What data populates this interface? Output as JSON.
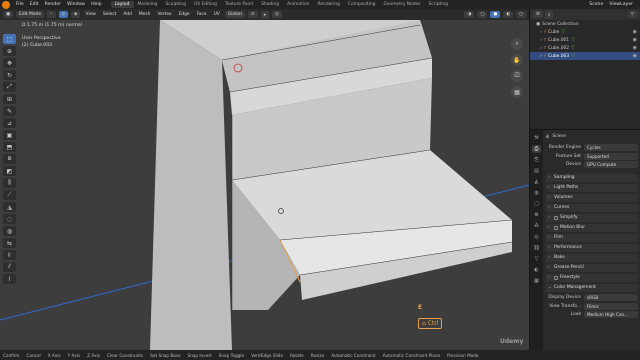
{
  "topbar": {
    "menus": [
      "File",
      "Edit",
      "Render",
      "Window",
      "Help"
    ],
    "workspaces": [
      "Layout",
      "Modeling",
      "Sculpting",
      "UV Editing",
      "Texture Paint",
      "Shading",
      "Animation",
      "Rendering",
      "Compositing",
      "Geometry Nodes",
      "Scripting"
    ],
    "active_workspace": "Layout",
    "scene_label": "Scene",
    "layer_label": "ViewLayer"
  },
  "viewport_header": {
    "mode": "Edit Mode",
    "menus": [
      "View",
      "Select",
      "Add",
      "Mesh",
      "Vertex",
      "Edge",
      "Face",
      "UV"
    ],
    "transform": "Global"
  },
  "viewport": {
    "info_line": "D 1.75 m (1.75 m) normal",
    "perspective": "User Perspective",
    "object": "(2) Cube.003",
    "key_hint": "E",
    "ctrl_label": "Ctrl",
    "watermark": "Udemy"
  },
  "outliner": {
    "collection": "Scene Collection",
    "items": [
      {
        "name": "Cube",
        "selected": false
      },
      {
        "name": "Cube.001",
        "selected": false
      },
      {
        "name": "Cube.002",
        "selected": false
      },
      {
        "name": "Cube.003",
        "selected": true
      }
    ]
  },
  "properties": {
    "scene": "Scene",
    "render_engine_label": "Render Engine",
    "render_engine": "Cycles",
    "feature_set_label": "Feature Set",
    "feature_set": "Supported",
    "device_label": "Device",
    "device": "GPU Compute",
    "panels": [
      "Sampling",
      "Light Paths",
      "Volumes",
      "Curves",
      "Simplify",
      "Motion Blur",
      "Film",
      "Performance",
      "Bake",
      "Grease Pencil",
      "Freestyle",
      "Color Management"
    ],
    "display_device_label": "Display Device",
    "display_device": "sRGB",
    "view_transform_label": "View Transfo...",
    "view_transform": "Filmic",
    "look_label": "Look",
    "look": "Medium High Con..."
  },
  "statusbar": [
    "Confirm",
    "Cancel",
    "X Axis",
    "Y Axis",
    "Z Axis",
    "Clear Constraints",
    "Set Snap Base",
    "Snap Invert",
    "Snap Toggle",
    "Vert/Edge Slide",
    "Rotate",
    "Resize",
    "Automatic Constraint",
    "Automatic Constraint Plane",
    "Precision Mode"
  ],
  "colors": {
    "accent": "#4772b3",
    "viewport_bg": "#3d3d3d",
    "hint": "#e8a04a",
    "axis": "#2f6bd4"
  }
}
